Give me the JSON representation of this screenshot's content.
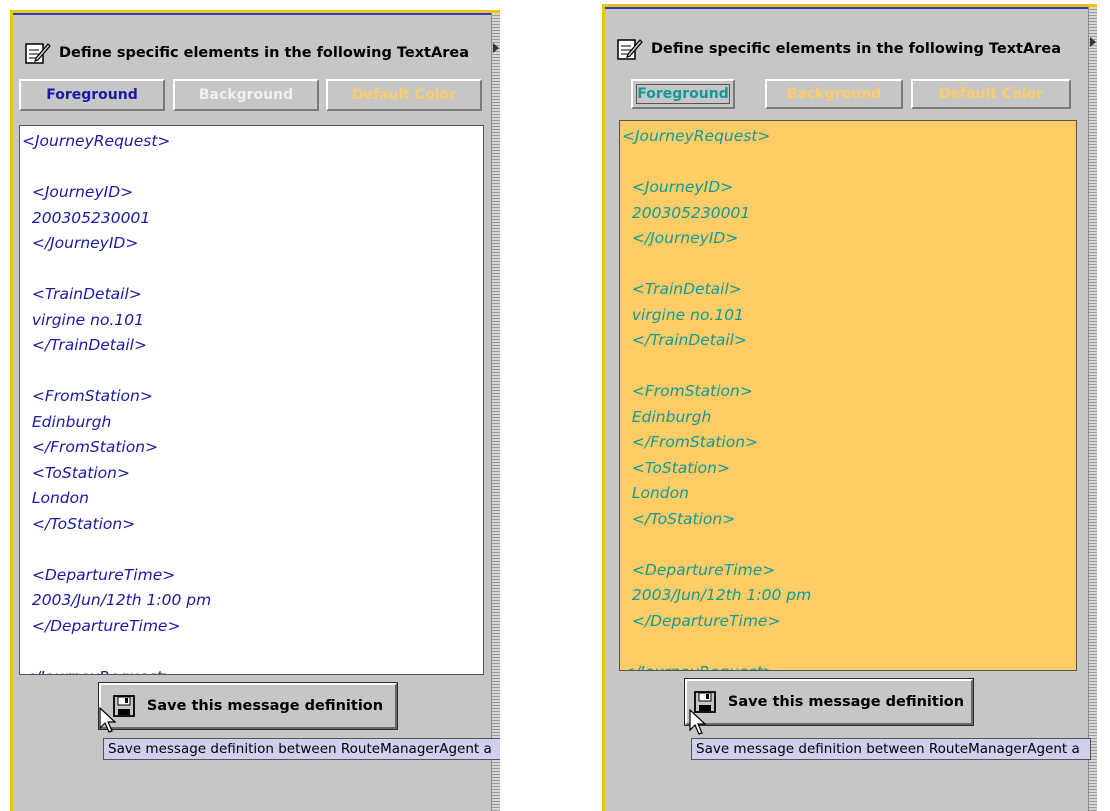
{
  "header": {
    "title": "Define specific elements in the following TextArea",
    "icon": "notepad-pencil-icon"
  },
  "buttons": {
    "foreground": "Foreground",
    "background": "Background",
    "default_color": "Default Color"
  },
  "colors": {
    "accent_border": "#f5c400",
    "text_blue": "#1a1aa6",
    "text_teal": "#0e9a9a",
    "orange_bg": "#ffcc66",
    "disabled_text_left": "#f0f0f0",
    "disabled_text_default": "#ffcc66",
    "tooltip_bg": "#cfd0ee"
  },
  "message_lines": [
    "<JourneyRequest>",
    "",
    "  <JourneyID>",
    "  200305230001",
    "  </JourneyID>",
    "",
    "  <TrainDetail>",
    "  virgine no.101",
    "  </TrainDetail>",
    "",
    "  <FromStation>",
    "  Edinburgh",
    "  </FromStation>",
    "  <ToStation>",
    "  London",
    "  </ToStation>",
    "",
    "  <DepartureTime>",
    "  2003/Jun/12th 1:00 pm",
    "  </DepartureTime>",
    "",
    "</JourneyRequest>"
  ],
  "save": {
    "label": "Save this message definition",
    "icon": "floppy-disk-icon"
  },
  "tooltip": {
    "left": "Save message definition between RouteManagerAgent a",
    "right": "Save message definition between RouteManagerAgent a"
  }
}
